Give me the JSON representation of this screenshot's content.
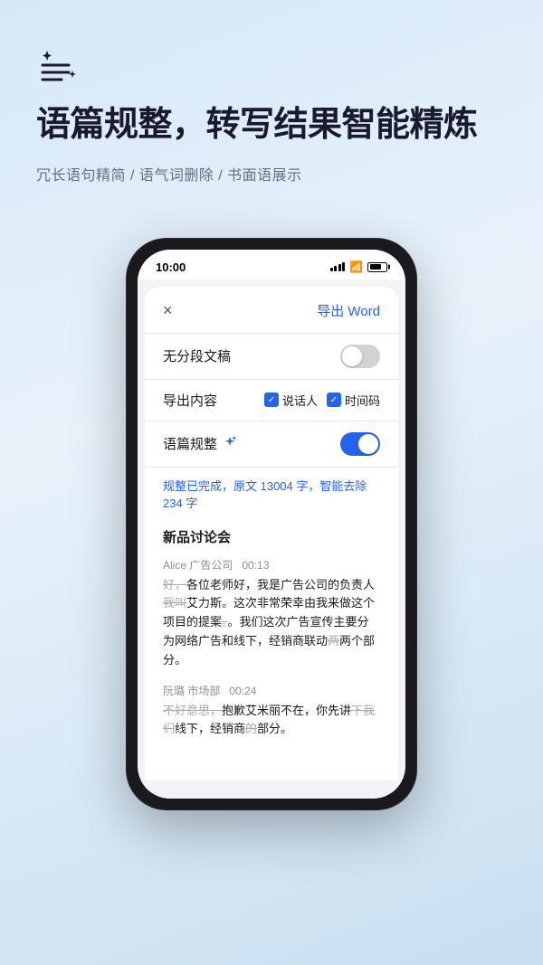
{
  "app": {
    "title": "语篇规整，转写结果智能精炼",
    "subtitle": "冗长语句精简 / 语气词删除 / 书面语展示",
    "logo_alt": "sparkle-list-icon"
  },
  "phone": {
    "status_bar": {
      "time": "10:00"
    },
    "modal": {
      "close_label": "×",
      "export_label": "导出 Word",
      "row1_label": "无分段文稿",
      "row2_label": "导出内容",
      "row2_option1": "说话人",
      "row2_option2": "时间码",
      "row3_label": "语篇规整",
      "status_text": "规整已完成，原文 13004 字，智能去除 234 字",
      "meeting_title": "新品讨论会",
      "speaker1_name": "Alice 广告公司",
      "speaker1_time": "00:13",
      "transcript1_pre": "好，各位老师好，我是广告公司的负责人",
      "transcript1_strike": "我叫",
      "transcript1_mid": "艾力斯。这次非常荣幸由我来做这个项目的提案",
      "transcript1_strike2": "。",
      "transcript1_end": "。我们这次广告宣传主要分为网络广告和线下，经销商联动",
      "transcript1_strike3": "两",
      "transcript1_fin": "两个部分。",
      "speaker2_name": "阮璐 市场部",
      "speaker2_time": "00:24",
      "transcript2_pre": "不好意思，抱歉艾米丽不在，你先讲",
      "transcript2_strike": "下我们",
      "transcript2_mid": "线下，经销商",
      "transcript2_strike2": "的",
      "transcript2_end": "部分。"
    }
  }
}
